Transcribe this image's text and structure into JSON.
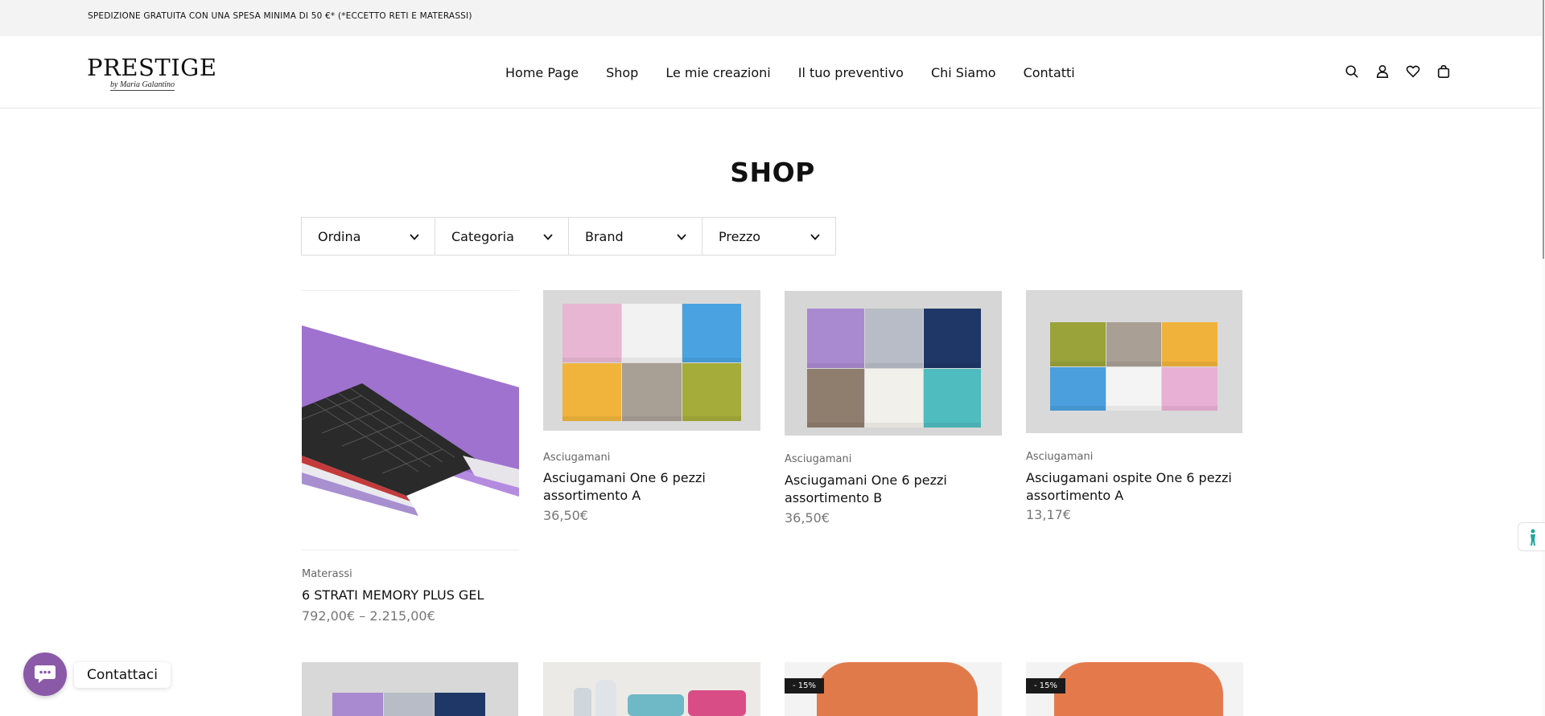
{
  "topbar": {
    "text": "SPEDIZIONE GRATUITA CON UNA SPESA MINIMA DI 50 €*  (*ECCETTO RETI E MATERASSI)"
  },
  "logo": {
    "main": "PRESTIGE",
    "sub": "by Maria Galantino"
  },
  "nav": [
    "Home Page",
    "Shop",
    "Le mie creazioni",
    "Il tuo preventivo",
    "Chi Siamo",
    "Contatti"
  ],
  "header_icons": [
    "search-icon",
    "user-icon",
    "heart-icon",
    "bag-icon"
  ],
  "page": {
    "title": "SHOP"
  },
  "filters": [
    "Ordina",
    "Categoria",
    "Brand",
    "Prezzo"
  ],
  "products": [
    {
      "category": "Materassi",
      "name": "6 STRATI MEMORY PLUS GEL",
      "price": "792,00€ – 2.215,00€"
    },
    {
      "category": "Asciugamani",
      "name": "Asciugamani One 6 pezzi assortimento A",
      "price": "36,50€"
    },
    {
      "category": "Asciugamani",
      "name": "Asciugamani One 6 pezzi assortimento B",
      "price": "36,50€"
    },
    {
      "category": "Asciugamani",
      "name": "Asciugamani ospite One 6 pezzi assortimento A",
      "price": "13,17€"
    }
  ],
  "row2_badges": [
    "- 15%",
    "- 15%"
  ],
  "towel_colors": {
    "a": [
      "#e8b6d2",
      "#f2f2f2",
      "#4aa3e0",
      "#f0b43c",
      "#a89f95",
      "#a5ac3a"
    ],
    "b": [
      "#a98ad0",
      "#b7bcc6",
      "#1f3766",
      "#8f7d6e",
      "#f1f0ea",
      "#4fbcbf"
    ],
    "c": [
      "#9aa23a",
      "#a99f94",
      "#f0b23a",
      "#4a9fdc",
      "#f4f4f4",
      "#e8b0d4"
    ]
  },
  "chat": {
    "label": "Contattaci"
  },
  "colors": {
    "accent_chat": "#8a5aa8",
    "accessibility": "#1aa89a",
    "badge": "#1a1a1a"
  }
}
